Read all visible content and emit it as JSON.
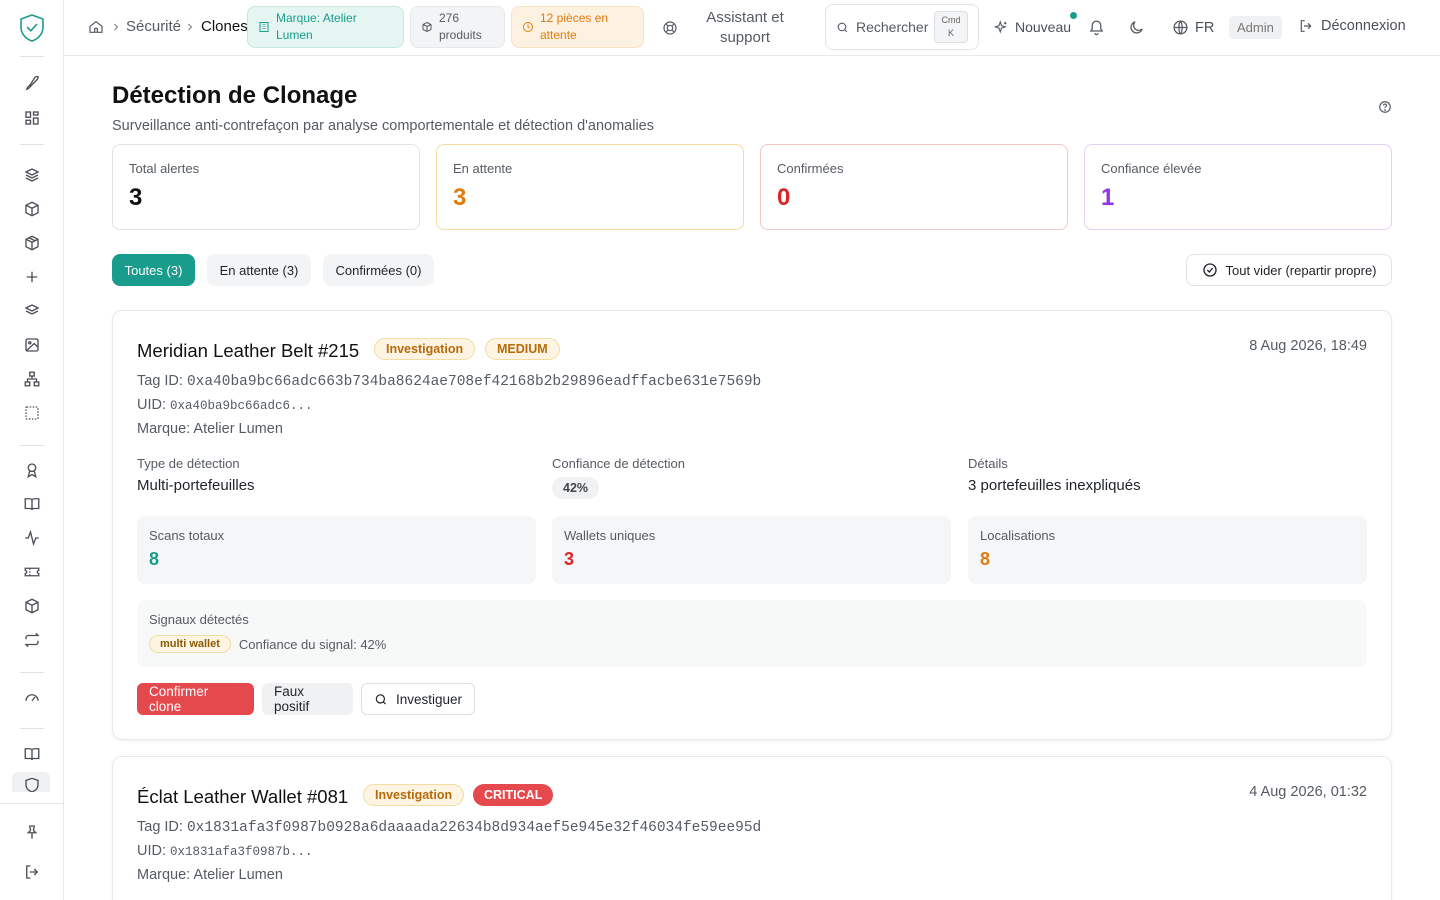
{
  "sidebar": {
    "icons": [
      "shield-logo",
      "rocket-icon",
      "dashboard-icon",
      "layers-icon",
      "box-icon",
      "package-icon",
      "plus-icon",
      "stack-icon",
      "image-icon",
      "sitemap-icon",
      "dotted-square-icon",
      "award-icon",
      "book-icon",
      "activity-icon",
      "ticket-icon",
      "package2-icon",
      "repeat-icon",
      "gauge-icon",
      "book-open-icon",
      "shield-active-icon",
      "pin-icon",
      "logout-icon"
    ]
  },
  "topbar": {
    "breadcrumb": [
      "Sécurité",
      "Clones"
    ],
    "brand_pill": "Marque: Atelier Lumen",
    "products_pill": "276 produits",
    "waiting_pill": "12 pièces en attente",
    "assistant": "Assistant et support",
    "search_label": "Rechercher",
    "search_kbd_1": "Cmd",
    "search_kbd_2": "K",
    "new_label": "Nouveau",
    "lang": "FR",
    "admin": "Admin",
    "logout": "Déconnexion"
  },
  "page": {
    "title": "Détection de Clonage",
    "subtitle": "Surveillance anti-contrefaçon par analyse comportementale et détection d'anomalies"
  },
  "stats": [
    {
      "label": "Total alertes",
      "value": "3",
      "color": "#111111",
      "border": "#e2e4e7"
    },
    {
      "label": "En attente",
      "value": "3",
      "color": "#e07b0c",
      "border": "#f4dca0"
    },
    {
      "label": "Confirmées",
      "value": "0",
      "color": "#dc2626",
      "border": "#f5c6c8"
    },
    {
      "label": "Confiance élevée",
      "value": "1",
      "color": "#9333ea",
      "border": "#e2d0f7"
    }
  ],
  "tabs": {
    "all": "Toutes (3)",
    "waiting": "En attente (3)",
    "confirmed": "Confirmées (0)",
    "clear": "Tout vider (repartir propre)"
  },
  "cards": [
    {
      "title": "Meridian Leather Belt #215",
      "status": "Investigation",
      "severity": "MEDIUM",
      "date": "8 Aug 2026, 18:49",
      "tag_label": "Tag ID: ",
      "tag": "0xa40ba9bc66adc663b734ba8624ae708ef42168b2b29896eadffacbe631e7569b",
      "uid_label": "UID: ",
      "uid": "0xa40ba9bc66adc6...",
      "brand": "Marque: Atelier Lumen",
      "type_label": "Type de détection",
      "type_value": "Multi-portefeuilles",
      "conf_label": "Confiance de détection",
      "conf_value": "42%",
      "details_label": "Détails",
      "details_value": "3 portefeuilles inexpliqués",
      "scans_label": "Scans totaux",
      "scans_value": "8",
      "wallets_label": "Wallets uniques",
      "wallets_value": "3",
      "loc_label": "Localisations",
      "loc_value": "8",
      "signals_label": "Signaux détectés",
      "signal_badge": "multi wallet",
      "signal_conf": "Confiance du signal: 42%",
      "btn_confirm": "Confirmer clone",
      "btn_false": "Faux positif",
      "btn_investigate": "Investiguer"
    },
    {
      "title": "Éclat Leather Wallet #081",
      "status": "Investigation",
      "severity": "CRITICAL",
      "date": "4 Aug 2026, 01:32",
      "tag_label": "Tag ID: ",
      "tag": "0x1831afa3f0987b0928a6daaaada22634b8d934aef5e945e32f46034fe59ee95d",
      "uid_label": "UID: ",
      "uid": "0x1831afa3f0987b...",
      "brand": "Marque: Atelier Lumen"
    }
  ]
}
